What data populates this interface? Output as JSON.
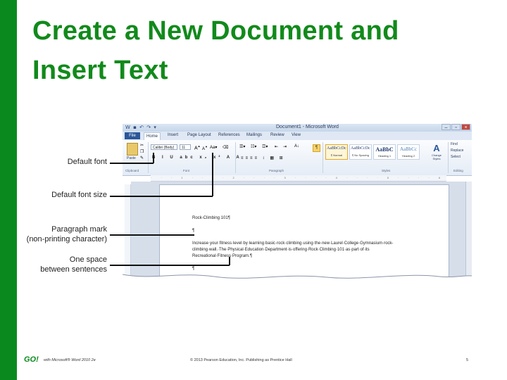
{
  "slide": {
    "title_line1": "Create a New Document and",
    "title_line2": "Insert Text",
    "accent_color": "#118a1b"
  },
  "word_window": {
    "title": "Document1 - Microsoft Word",
    "qat_icons": [
      "word-logo-icon",
      "save-icon",
      "undo-icon",
      "redo-icon",
      "customize-icon"
    ],
    "tabs": [
      "File",
      "Home",
      "Insert",
      "Page Layout",
      "References",
      "Mailings",
      "Review",
      "View"
    ],
    "active_tab": "Home",
    "font_name": "Calibri (Body)",
    "font_size": "11",
    "paste_label": "Paste",
    "group_labels": [
      "Clipboard",
      "Font",
      "Paragraph",
      "Styles",
      "Editing"
    ],
    "styles": [
      {
        "sample": "AaBbCcDc",
        "name": "¶ Normal"
      },
      {
        "sample": "AaBbCcDc",
        "name": "¶ No Spacing"
      },
      {
        "sample": "AaBbC",
        "name": "Heading 1"
      },
      {
        "sample": "AaBbCc",
        "name": "Heading 2"
      }
    ],
    "change_styles": "Change Styles",
    "editing": [
      "Find",
      "Replace",
      "Select"
    ],
    "show_hide_symbol": "¶",
    "doc_lines": [
      "Rock-Climbing 101¶",
      "¶",
      "Increase·your·fitness·level·by·learning·basic·rock·climbing·using·the·new·Laurel·College·Gymnasium·rock-",
      "climbing·wall.·The·Physical·Education·Department·is·offering·Rock·Climbing·101·as·part·of·its",
      "Recreational·Fitness·Program.¶",
      "¶"
    ]
  },
  "callouts": {
    "default_font": "Default font",
    "default_font_size": "Default font size",
    "paragraph_mark_1": "Paragraph mark",
    "paragraph_mark_2": "(non-printing character)",
    "one_space_1": "One space",
    "one_space_2": "between sentences"
  },
  "footer": {
    "logo": "GO!",
    "series": "with Microsoft® Word 2010 2e",
    "copyright": "© 2013 Pearson Education, Inc. Publishing as Prentice Hall",
    "page_number": "5"
  }
}
